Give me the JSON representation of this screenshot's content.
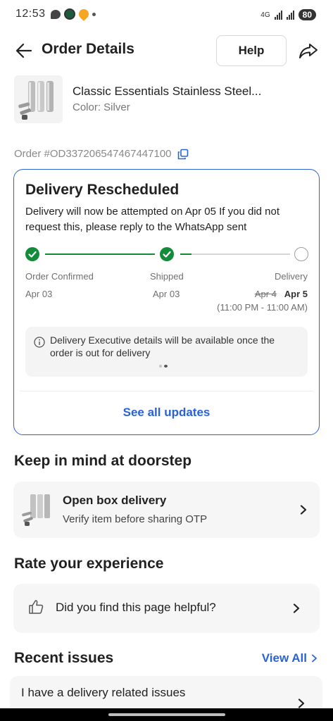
{
  "status_bar": {
    "time": "12:53",
    "network_label": "4G",
    "battery": "80"
  },
  "header": {
    "title": "Order Details",
    "help_label": "Help"
  },
  "product": {
    "name": "Classic Essentials Stainless Steel...",
    "color": "Color: Silver"
  },
  "order": {
    "id_text": "Order #OD337206547467447100"
  },
  "delivery": {
    "title": "Delivery Rescheduled",
    "description": "Delivery will now be attempted on Apr 05 If you did not request this, please reply to the WhatsApp sent",
    "steps": [
      {
        "label": "Order Confirmed",
        "date": "Apr 03",
        "status": "done"
      },
      {
        "label": "Shipped",
        "date": "Apr 03",
        "status": "done"
      },
      {
        "label": "Delivery",
        "old_date": "Apr 4",
        "new_date": "Apr 5",
        "time_window": "(11:00 PM - 11:00 AM)",
        "status": "pending"
      }
    ],
    "shipped_progress": 0.1,
    "info_text": "Delivery Executive details will be available once the order is out for delivery",
    "pager_active_index": 1,
    "pager_count": 2,
    "see_updates_label": "See all updates",
    "colors": {
      "done": "#128c3a",
      "accent": "#2a62d8"
    }
  },
  "doorstep": {
    "title": "Keep in mind at doorstep",
    "item_title": "Open box delivery",
    "item_subtitle": "Verify item before sharing OTP"
  },
  "rate": {
    "title": "Rate your experience",
    "question": "Did you find this page helpful?"
  },
  "issues": {
    "title": "Recent issues",
    "view_all_label": "View All",
    "items": [
      {
        "label": "I have a delivery related issues"
      }
    ]
  }
}
